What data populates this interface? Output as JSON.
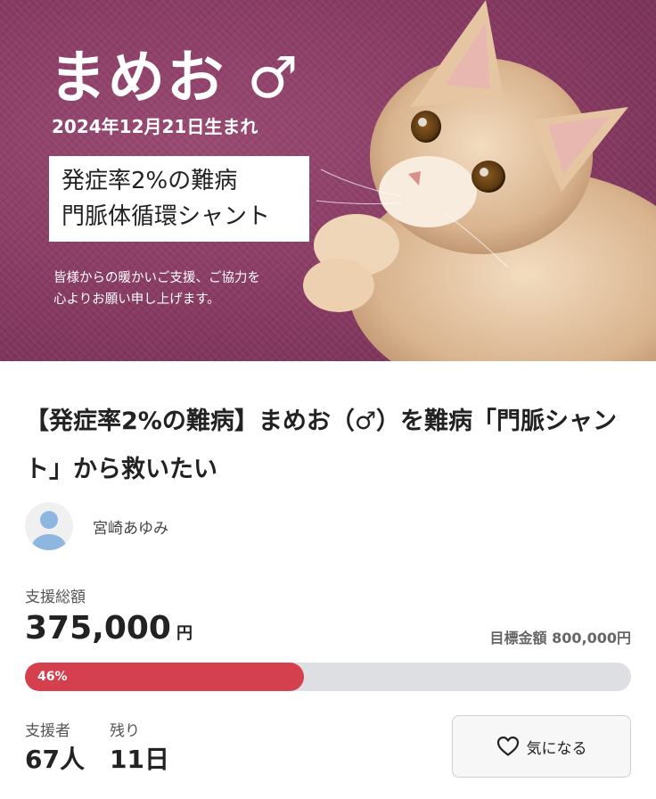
{
  "hero": {
    "name": "まめお ♂",
    "birth": "2024年12月21日生まれ",
    "disease_line1": "発症率2%の難病",
    "disease_line2": "門脈体循環シャント",
    "message_line1": "皆様からの暖かいご支援、ご協力を",
    "message_line2": "心よりお願い申し上げます。",
    "cat_icon": "cat-photo"
  },
  "project": {
    "title": "【発症率2%の難病】まめお（♂）を難病「門脈シャント」から救いたい"
  },
  "author": {
    "name": "宮崎あゆみ",
    "avatar_icon": "user-avatar-icon"
  },
  "funding": {
    "raised_label": "支援総額",
    "raised_amount": "375,000",
    "currency": "円",
    "goal_text": "目標金額 800,000円",
    "progress_percent": 46,
    "progress_label": "46%",
    "progress_color": "#d5404e",
    "supporters_label": "支援者",
    "supporters_value": "67人",
    "remaining_label": "残り",
    "remaining_value": "11日"
  },
  "actions": {
    "favorite_label": "気になる",
    "favorite_icon": "heart-icon"
  }
}
